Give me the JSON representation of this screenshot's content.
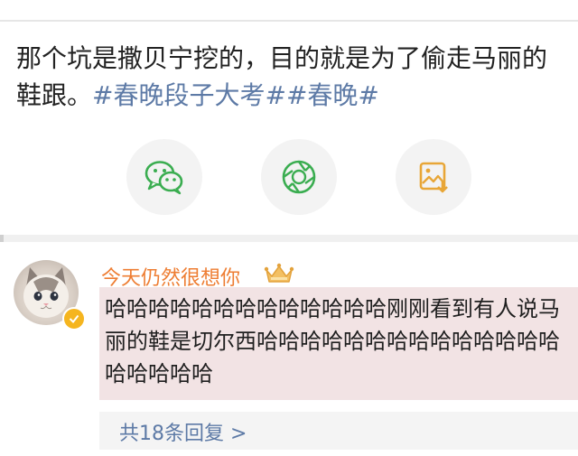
{
  "post": {
    "text": "那个坑是撒贝宁挖的，目的就是为了偷走马丽的鞋跟。",
    "hashtags": "#春晚段子大考##春晚#"
  },
  "share_actions": [
    {
      "icon": "wechat-icon",
      "color": "#3aad50"
    },
    {
      "icon": "moments-icon",
      "color": "#3aad50"
    },
    {
      "icon": "save-image-icon",
      "color": "#e8a637"
    }
  ],
  "comment": {
    "username": "今天仍然很想你",
    "text": "哈哈哈哈哈哈哈哈哈哈哈哈哈刚刚看到有人说马丽的鞋是切尔西哈哈哈哈哈哈哈哈哈哈哈哈哈哈哈哈哈哈哈",
    "replies_label": "共18条回复 >"
  },
  "colors": {
    "link": "#5d7aa6",
    "username": "#ee7d32",
    "highlight": "#f2e3e4"
  }
}
